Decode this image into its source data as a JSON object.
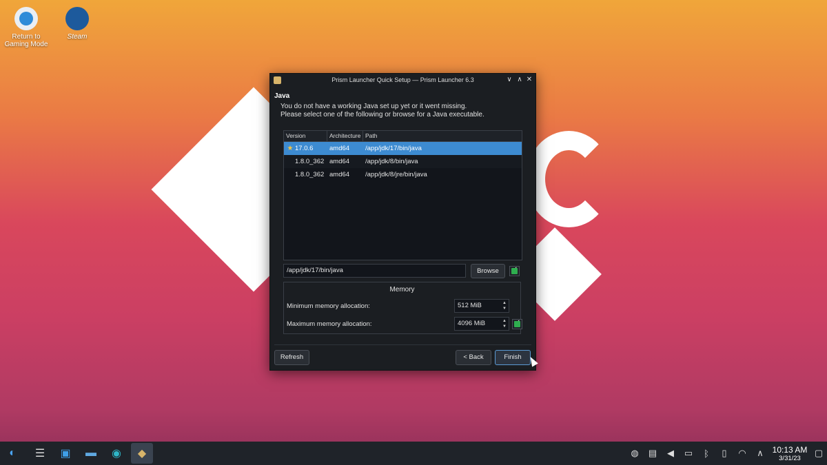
{
  "desktop": {
    "icons": [
      {
        "label_line1": "Return to",
        "label_line2": "Gaming Mode",
        "icon": "return-arrow-icon"
      },
      {
        "label_line1": "Steam",
        "label_line2": "",
        "icon": "steam-icon"
      }
    ]
  },
  "window": {
    "title": "Prism Launcher Quick Setup — Prism Launcher 6.3",
    "controls": {
      "minimize": "∨",
      "maximize": "∧",
      "close": "✕"
    },
    "section_title": "Java",
    "desc_line1": "You do not have a working Java set up yet or it went missing.",
    "desc_line2": "Please select one of the following or browse for a Java executable.",
    "table": {
      "columns": [
        "Version",
        "Architecture",
        "Path"
      ],
      "rows": [
        {
          "version": "17.0.6",
          "arch": "amd64",
          "path": "/app/jdk/17/bin/java",
          "recommended": true,
          "selected": true
        },
        {
          "version": "1.8.0_362",
          "arch": "amd64",
          "path": "/app/jdk/8/bin/java",
          "recommended": false,
          "selected": false
        },
        {
          "version": "1.8.0_362",
          "arch": "amd64",
          "path": "/app/jdk/8/jre/bin/java",
          "recommended": false,
          "selected": false
        }
      ]
    },
    "java_path_value": "/app/jdk/17/bin/java",
    "browse_label": "Browse",
    "memory": {
      "title": "Memory",
      "min_label": "Minimum memory allocation:",
      "min_value": "512 MiB",
      "max_label": "Maximum memory allocation:",
      "max_value": "4096 MiB"
    },
    "buttons": {
      "refresh": "Refresh",
      "back": "< Back",
      "finish": "Finish"
    }
  },
  "taskbar": {
    "apps": [
      "app-launcher-icon",
      "system-settings-icon",
      "discover-store-icon",
      "file-manager-icon",
      "edge-browser-icon",
      "prism-launcher-icon"
    ],
    "tray": [
      "steam-tray-icon",
      "clipboard-icon",
      "volume-icon",
      "battery-icon",
      "bluetooth-icon",
      "usb-device-icon",
      "wifi-icon",
      "expand-tray-icon"
    ],
    "time": "10:13 AM",
    "date": "3/31/23"
  },
  "colors": {
    "selection": "#3d8bd1",
    "window_bg": "#1b1e22",
    "check_green": "#2fae4f"
  }
}
